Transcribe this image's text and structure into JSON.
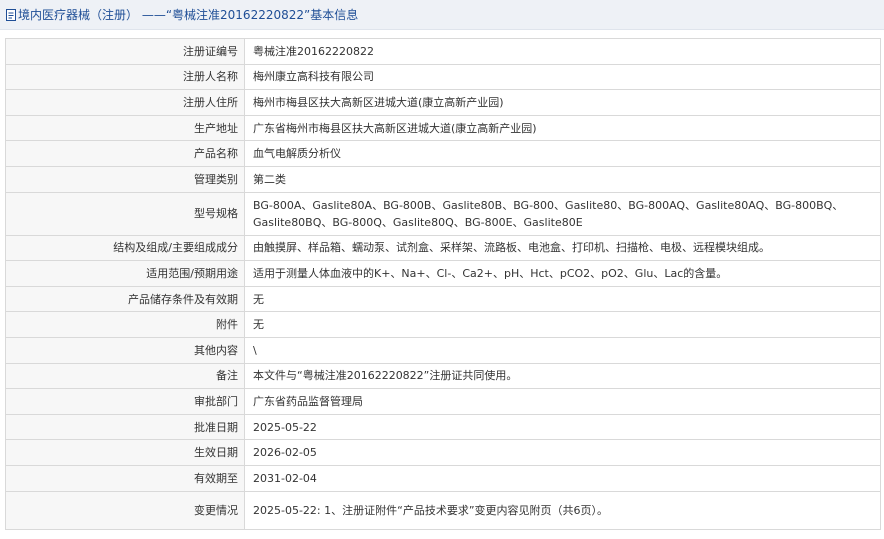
{
  "header": {
    "title": "境内医疗器械（注册） ——“粤械注准20162220822”基本信息"
  },
  "rows": [
    {
      "label": "注册证编号",
      "value": "粤械注准20162220822"
    },
    {
      "label": "注册人名称",
      "value": "梅州康立高科技有限公司"
    },
    {
      "label": "注册人住所",
      "value": "梅州市梅县区扶大高新区进城大道(康立高新产业园)"
    },
    {
      "label": "生产地址",
      "value": "广东省梅州市梅县区扶大高新区进城大道(康立高新产业园)"
    },
    {
      "label": "产品名称",
      "value": "血气电解质分析仪"
    },
    {
      "label": "管理类别",
      "value": "第二类"
    },
    {
      "label": "型号规格",
      "value": "BG-800A、Gaslite80A、BG-800B、Gaslite80B、BG-800、Gaslite80、BG-800AQ、Gaslite80AQ、BG-800BQ、Gaslite80BQ、BG-800Q、Gaslite80Q、BG-800E、Gaslite80E"
    },
    {
      "label": "结构及组成/主要组成成分",
      "value": "由触摸屏、样品箱、蠕动泵、试剂盒、采样架、流路板、电池盒、打印机、扫描枪、电极、远程模块组成。"
    },
    {
      "label": "适用范围/预期用途",
      "value": "适用于测量人体血液中的K+、Na+、Cl-、Ca2+、pH、Hct、pCO2、pO2、Glu、Lac的含量。"
    },
    {
      "label": "产品储存条件及有效期",
      "value": "无"
    },
    {
      "label": "附件",
      "value": "无"
    },
    {
      "label": "其他内容",
      "value": "\\"
    },
    {
      "label": "备注",
      "value": "本文件与“粤械注准20162220822”注册证共同使用。"
    },
    {
      "label": "审批部门",
      "value": "广东省药品监督管理局"
    },
    {
      "label": "批准日期",
      "value": "2025-05-22"
    },
    {
      "label": "生效日期",
      "value": "2026-02-05"
    },
    {
      "label": "有效期至",
      "value": "2031-02-04"
    },
    {
      "label": "变更情况",
      "value": "2025-05-22: 1、注册证附件“产品技术要求”变更内容见附页（共6页）。"
    }
  ]
}
